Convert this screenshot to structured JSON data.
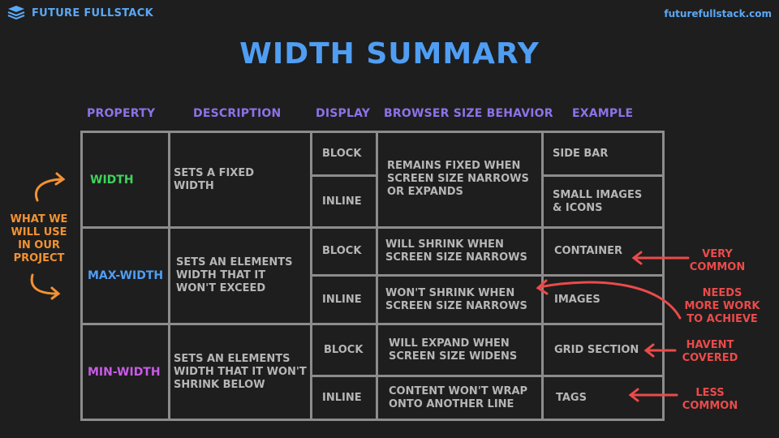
{
  "brand": {
    "name": "FUTURE FULLSTACK",
    "site": "futurefullstack.com",
    "logo_icon": "stacked-layers-icon"
  },
  "title": "WIDTH SUMMARY",
  "headers": {
    "property": "PROPERTY",
    "description": "DESCRIPTION",
    "display": "DISPLAY",
    "behavior": "BROWSER SIZE BEHAVIOR",
    "example": "EXAMPLE"
  },
  "rows": [
    {
      "property": "WIDTH",
      "property_color": "#3fd35c",
      "description": "SETS A FIXED\n WIDTH",
      "behavior": "REMAINS FIXED WHEN\nSCREEN SIZE NARROWS\nOR EXPANDS",
      "sub": [
        {
          "display": "BLOCK",
          "example": "SIDE BAR"
        },
        {
          "display": "INLINE",
          "example": "SMALL IMAGES\n& ICONS"
        }
      ]
    },
    {
      "property": "MAX-WIDTH",
      "property_color": "#4f9ef3",
      "description": "SETS AN ELEMENTS\nWIDTH THAT IT\nWON'T EXCEED",
      "sub": [
        {
          "display": "BLOCK",
          "behavior": "WILL SHRINK WHEN\nSCREEN SIZE NARROWS",
          "example": "CONTAINER"
        },
        {
          "display": "INLINE",
          "behavior": "WON'T SHRINK WHEN\nSCREEN SIZE NARROWS",
          "example": "IMAGES"
        }
      ]
    },
    {
      "property": "MIN-WIDTH",
      "property_color": "#c85be6",
      "description": "SETS AN ELEMENTS\nWIDTH THAT IT WON'T\nSHRINK BELOW",
      "sub": [
        {
          "display": "BLOCK",
          "behavior": "WILL EXPAND WHEN\nSCREEN SIZE WIDENS",
          "example": "GRID SECTION"
        },
        {
          "display": "INLINE",
          "behavior": "CONTENT WON'T WRAP\nONTO ANOTHER LINE",
          "example": "TAGS"
        }
      ]
    }
  ],
  "notes": {
    "left": "WHAT WE\nWILL USE\nIN OUR\nPROJECT",
    "very_common": "VERY\nCOMMON",
    "needs_more_work": "NEEDS\nMORE WORK\nTO ACHIEVE",
    "havent_covered": "HAVENT\nCOVERED",
    "less_common": "LESS\nCOMMON"
  },
  "colors": {
    "accent": "#4f9ef3",
    "header": "#8d72e8",
    "annotation_red": "#ec4a4a",
    "annotation_orange": "#f29233",
    "grid": "#8c8c8c"
  }
}
